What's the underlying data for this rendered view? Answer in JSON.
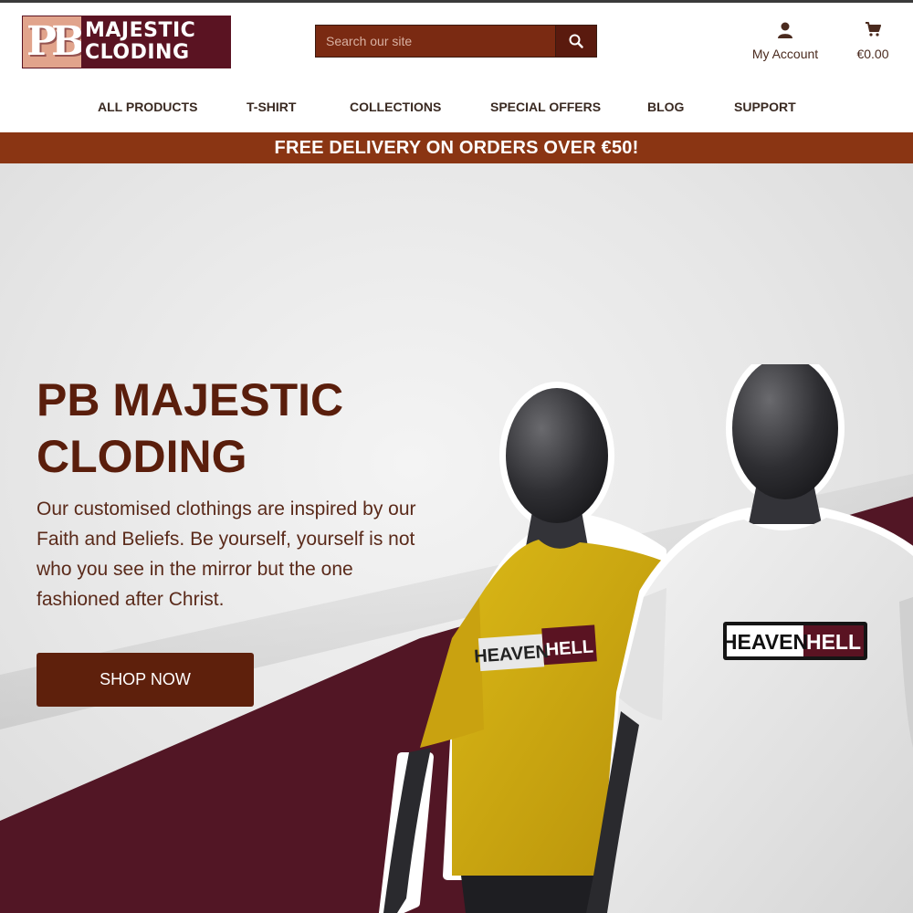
{
  "brand": {
    "logo_monogram": "PB",
    "logo_line1": "MAJESTIC",
    "logo_line2": "CLODING",
    "colors": {
      "primary": "#5a1322",
      "accent": "#8a3513",
      "button": "#5e200c",
      "logo_mark": "#e1a48c"
    }
  },
  "search": {
    "placeholder": "Search our site",
    "icon": "search-icon"
  },
  "account": {
    "label": "My Account",
    "icon": "user-icon"
  },
  "cart": {
    "total": "€0.00",
    "icon": "cart-icon"
  },
  "nav": {
    "items": [
      {
        "label": "ALL PRODUCTS"
      },
      {
        "label": "T-SHIRT"
      },
      {
        "label": "COLLECTIONS"
      },
      {
        "label": "SPECIAL OFFERS"
      },
      {
        "label": "BLOG"
      },
      {
        "label": "SUPPORT"
      }
    ]
  },
  "promo": {
    "text": "FREE DELIVERY ON ORDERS OVER €50!"
  },
  "hero": {
    "title_line1": "PB MAJESTIC",
    "title_line2": "CLODING",
    "description": "Our customised clothings are inspired by our Faith and Beliefs. Be yourself, yourself is not who you see in the mirror but the one fashioned after Christ.",
    "cta": "SHOP NOW",
    "products": [
      {
        "color_name": "yellow",
        "color": "#d1ab10",
        "print_left": "HEAVEN",
        "print_right": "HELL"
      },
      {
        "color_name": "white",
        "color": "#ebebeb",
        "print_left": "HEAVEN",
        "print_right": "HELL"
      }
    ]
  }
}
